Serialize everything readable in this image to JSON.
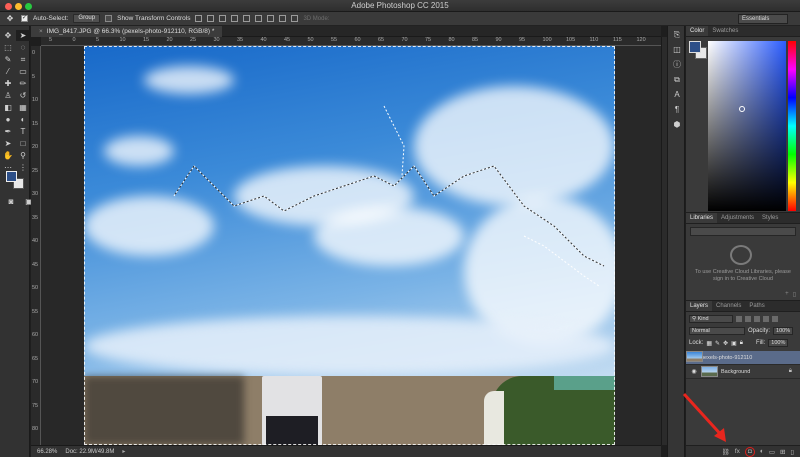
{
  "window": {
    "title": "Adobe Photoshop CC 2015"
  },
  "options": {
    "auto_select_label": "Auto-Select:",
    "auto_select_value": "Group",
    "show_transform_label": "Show Transform Controls",
    "mode3d_label": "3D Mode:",
    "workspace": "Essentials"
  },
  "document": {
    "tab_title": "IMG_8417.JPG @ 66.3% (pexels-photo-912110, RGB/8) *",
    "ruler_h": [
      "5",
      "0",
      "5",
      "10",
      "15",
      "20",
      "25",
      "30",
      "35",
      "40",
      "45",
      "50",
      "55",
      "60",
      "65",
      "70",
      "75",
      "80",
      "85",
      "90",
      "95",
      "100",
      "105",
      "110",
      "115",
      "120"
    ],
    "ruler_v": [
      "0",
      "5",
      "10",
      "15",
      "20",
      "25",
      "30",
      "35",
      "40",
      "45",
      "50",
      "55",
      "60",
      "65",
      "70",
      "75",
      "80"
    ]
  },
  "status": {
    "zoom": "66.28%",
    "doc": "Doc: 22.9M/49.8M"
  },
  "panels": {
    "color_tabs": [
      "Color",
      "Swatches"
    ],
    "library_tabs": [
      "Libraries",
      "Adjustments",
      "Styles"
    ],
    "library_message": "To use Creative Cloud Libraries, please sign in to Creative Cloud",
    "layer_tabs": [
      "Layers",
      "Channels",
      "Paths"
    ],
    "kind_label": "Kind",
    "blend_mode": "Normal",
    "opacity_label": "Opacity:",
    "opacity_value": "100%",
    "lock_label": "Lock:",
    "fill_label": "Fill:",
    "fill_value": "100%",
    "layers": [
      {
        "name": "pexels-photo-912110",
        "selected": true
      },
      {
        "name": "Background",
        "selected": false
      }
    ]
  },
  "colors": {
    "foreground": "#2d4f88",
    "background": "#e8e8e8",
    "annotation_arrow": "#e8261e"
  },
  "icons": [
    "move-tool-icon",
    "marquee-tool-icon",
    "lasso-tool-icon",
    "quick-selection-tool-icon",
    "crop-tool-icon",
    "eyedropper-tool-icon",
    "healing-brush-icon",
    "brush-tool-icon",
    "clone-stamp-icon",
    "history-brush-icon",
    "eraser-tool-icon",
    "gradient-tool-icon",
    "blur-tool-icon",
    "dodge-tool-icon",
    "pen-tool-icon",
    "type-tool-icon",
    "path-selection-icon",
    "rectangle-tool-icon",
    "hand-tool-icon",
    "zoom-tool-icon",
    "add-layer-mask-icon"
  ]
}
